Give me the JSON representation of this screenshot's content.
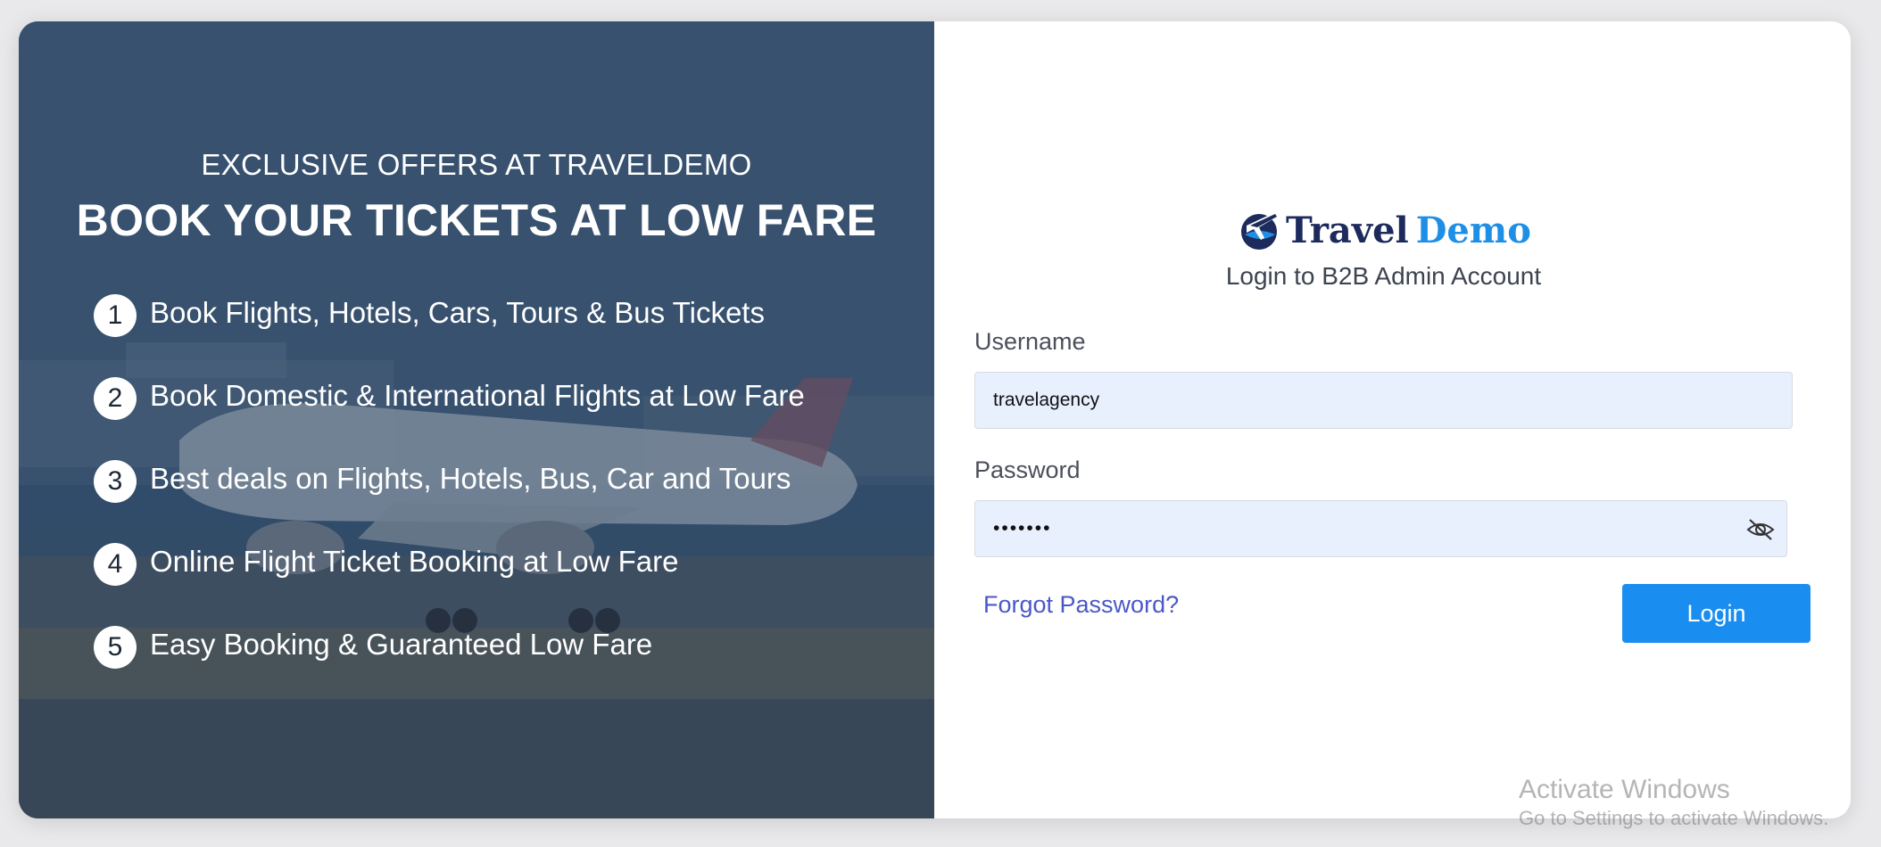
{
  "promo": {
    "eyebrow": "EXCLUSIVE OFFERS AT TRAVELDEMO",
    "headline": "BOOK YOUR TICKETS AT LOW FARE",
    "features": [
      {
        "num": "1",
        "text": "Book Flights, Hotels, Cars, Tours & Bus Tickets"
      },
      {
        "num": "2",
        "text": "Book Domestic & International Flights at Low Fare"
      },
      {
        "num": "3",
        "text": "Best deals on Flights, Hotels, Bus, Car and Tours"
      },
      {
        "num": "4",
        "text": "Online Flight Ticket Booking at Low Fare"
      },
      {
        "num": "5",
        "text": "Easy Booking & Guaranteed Low Fare"
      }
    ],
    "background_image": "airplane-on-runway",
    "overlay_color": "#2d4866"
  },
  "login": {
    "logo": {
      "part1": "Travel",
      "part2": "Demo",
      "part1_color": "#1d2a5c",
      "part2_color": "#1d8fe6"
    },
    "subtitle": "Login to B2B Admin Account",
    "username_label": "Username",
    "username_value": "travelagency",
    "password_label": "Password",
    "password_value": "•••••••",
    "password_toggle_icon": "eye-slash-icon",
    "forgot_label": "Forgot Password?",
    "login_label": "Login",
    "accent_color": "#1a8ef0",
    "input_bg_color": "#e8effd"
  },
  "watermark": {
    "title": "Activate Windows",
    "subtitle": "Go to Settings to activate Windows."
  }
}
